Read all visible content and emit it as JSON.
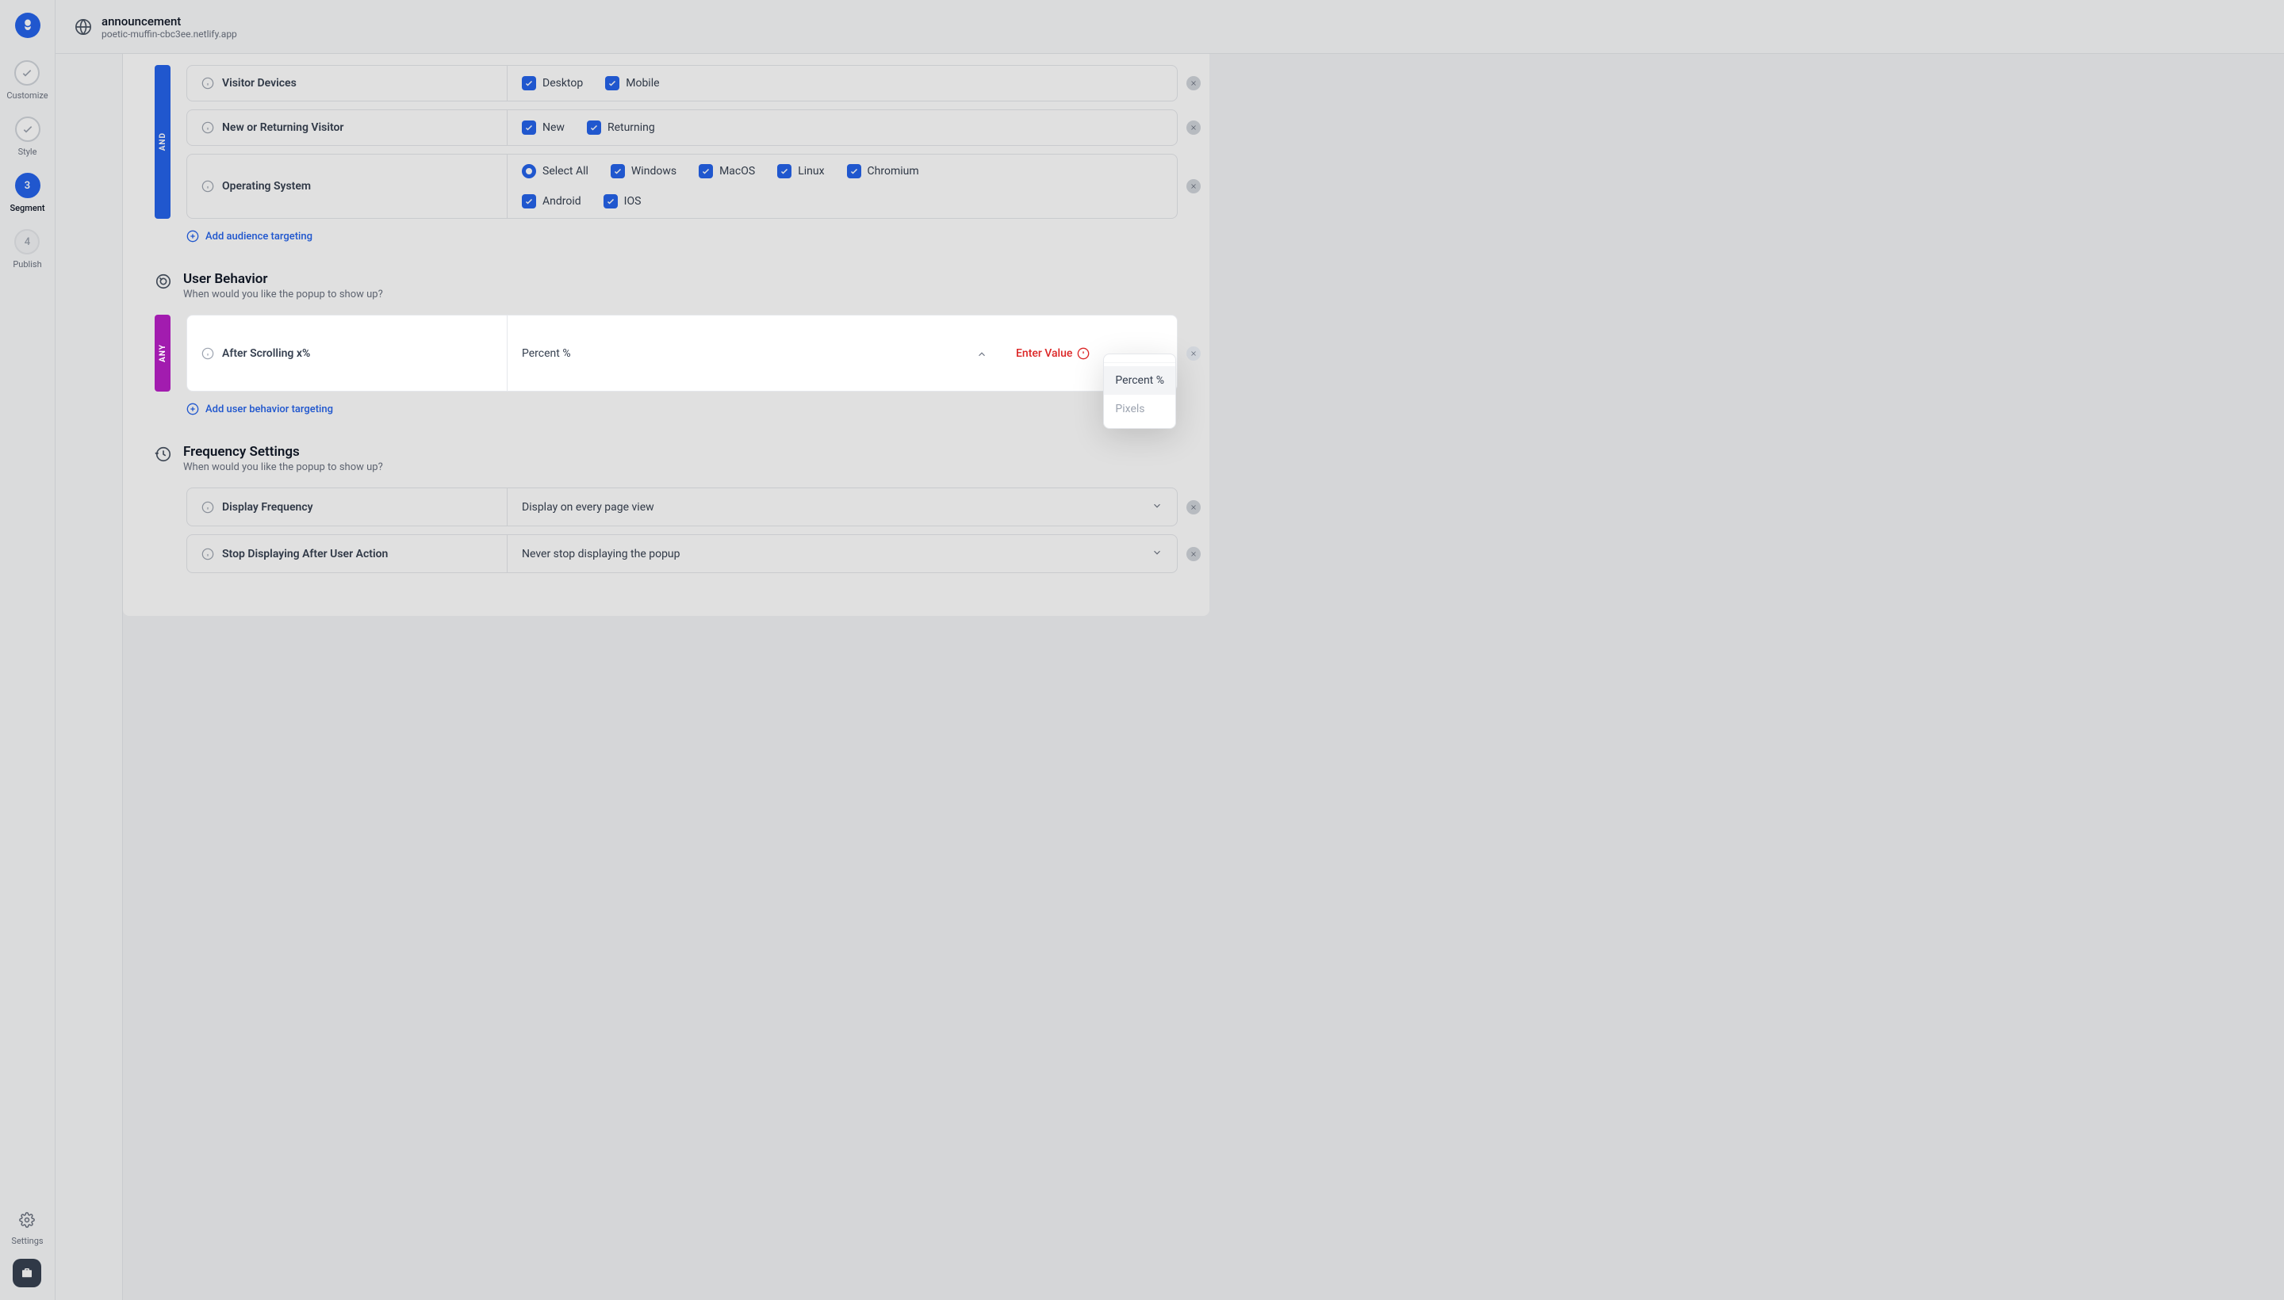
{
  "header": {
    "title": "announcement",
    "subtitle": "poetic-muffin-cbc3ee.netlify.app"
  },
  "sidebar": {
    "steps": [
      {
        "label": "Customize",
        "state": "done"
      },
      {
        "label": "Style",
        "state": "done"
      },
      {
        "label": "Segment",
        "state": "active",
        "num": "3"
      },
      {
        "label": "Publish",
        "state": "pending",
        "num": "4"
      }
    ],
    "settings_label": "Settings"
  },
  "audience": {
    "and_tag": "AND",
    "rules": [
      {
        "label": "Visitor Devices",
        "options": [
          {
            "label": "Desktop",
            "checked": true
          },
          {
            "label": "Mobile",
            "checked": true
          }
        ]
      },
      {
        "label": "New or Returning Visitor",
        "options": [
          {
            "label": "New",
            "checked": true
          },
          {
            "label": "Returning",
            "checked": true
          }
        ]
      },
      {
        "label": "Operating System",
        "select_all": "Select All",
        "options": [
          {
            "label": "Windows",
            "checked": true
          },
          {
            "label": "MacOS",
            "checked": true
          },
          {
            "label": "Linux",
            "checked": true
          },
          {
            "label": "Chromium",
            "checked": true
          },
          {
            "label": "Android",
            "checked": true
          },
          {
            "label": "IOS",
            "checked": true
          }
        ]
      }
    ],
    "add_link": "Add audience targeting"
  },
  "behavior": {
    "title": "User Behavior",
    "subtitle": "When would you like the popup to show up?",
    "any_tag": "ANY",
    "rule": {
      "label": "After Scrolling x%",
      "selected": "Percent %",
      "options": [
        "Percent %",
        "Pixels"
      ],
      "error": "Enter Value"
    },
    "add_link": "Add user behavior targeting"
  },
  "frequency": {
    "title": "Frequency Settings",
    "subtitle": "When would you like the popup to show up?",
    "rules": [
      {
        "label": "Display Frequency",
        "value": "Display on every page view"
      },
      {
        "label": "Stop Displaying After User Action",
        "value": "Never stop displaying the popup"
      }
    ]
  }
}
